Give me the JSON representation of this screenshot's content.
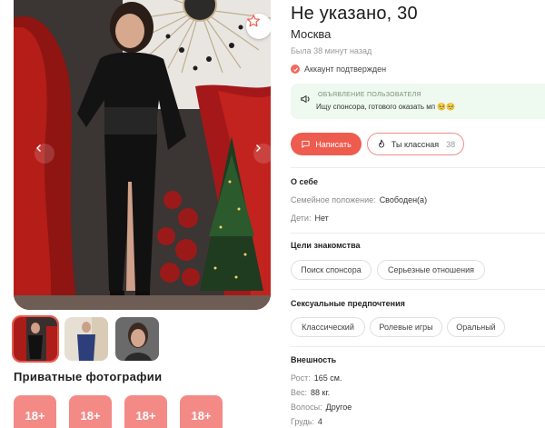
{
  "profile": {
    "name": "Не указано, 30",
    "city": "Москва",
    "last_seen": "Была 38 минут назад",
    "verified": "Аккаунт подтвержден"
  },
  "ad": {
    "label": "ОБЪЯВЛЕНИЕ ПОЛЬЗОВАТЕЛЯ",
    "text": "Ищу спонсора, готового оказать мп 🥺🥺"
  },
  "actions": {
    "write_label": "Написать",
    "like_label": "Ты классная",
    "like_count": "38"
  },
  "about": {
    "title": "О себе",
    "rows": [
      {
        "label": "Семейное положение:",
        "value": "Свободен(а)"
      },
      {
        "label": "Дети:",
        "value": "Нет"
      }
    ]
  },
  "goals": {
    "title": "Цели знакомства",
    "chips": [
      "Поиск спонсора",
      "Серьезные отношения"
    ]
  },
  "preferences": {
    "title": "Сексуальные предпочтения",
    "chips": [
      "Классический",
      "Ролевые игры",
      "Оральный"
    ]
  },
  "appearance": {
    "title": "Внешность",
    "rows": [
      {
        "label": "Рост:",
        "value": "165 см."
      },
      {
        "label": "Вес:",
        "value": "88 кг."
      },
      {
        "label": "Волосы:",
        "value": "Другое"
      },
      {
        "label": "Грудь:",
        "value": "4"
      }
    ]
  },
  "private": {
    "title": "Приватные фотографии",
    "tiles": [
      "18+",
      "18+",
      "18+",
      "18+"
    ]
  },
  "icons": {
    "favorite": "star-icon",
    "prev": "chevron-left-icon",
    "next": "chevron-right-icon",
    "verified": "check-circle-icon",
    "ad": "megaphone-icon",
    "write": "chat-icon",
    "like": "flame-icon"
  },
  "colors": {
    "accent": "#ee5b4f",
    "private_tile": "#f38a86",
    "ad_bg": "#eef9ef"
  }
}
